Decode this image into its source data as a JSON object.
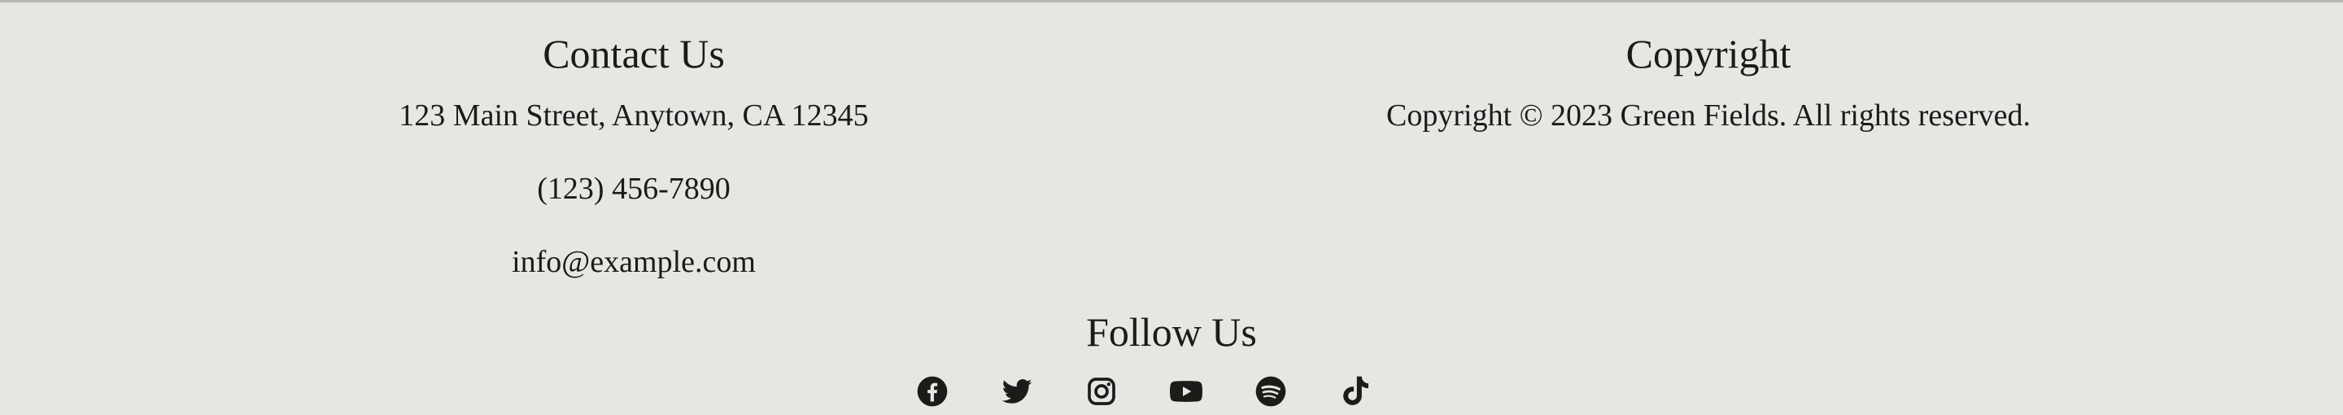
{
  "contact": {
    "heading": "Contact Us",
    "address": "123 Main Street, Anytown, CA 12345",
    "phone": "(123) 456-7890",
    "email": "info@example.com"
  },
  "copyright": {
    "heading": "Copyright",
    "text": "Copyright © 2023 Green Fields. All rights reserved."
  },
  "follow": {
    "heading": "Follow Us",
    "icons": [
      "facebook-icon",
      "twitter-icon",
      "instagram-icon",
      "youtube-icon",
      "spotify-icon",
      "tiktok-icon"
    ]
  },
  "colors": {
    "background": "#e7e6e2",
    "text": "#1d1b1a",
    "divider": "#b9b8b5"
  }
}
